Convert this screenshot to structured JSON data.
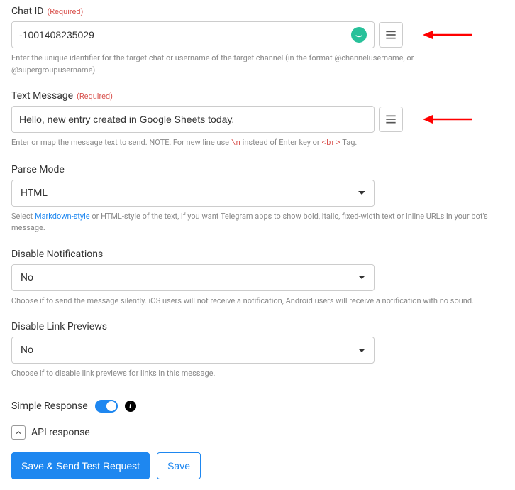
{
  "chat_id": {
    "label": "Chat ID",
    "required": "(Required)",
    "value": "-1001408235029",
    "help": "Enter the unique identifier for the target chat or username of the target channel (in the format @channelusername, or @supergroupusername)."
  },
  "text_message": {
    "label": "Text Message",
    "required": "(Required)",
    "value": "Hello, new entry created in Google Sheets today.",
    "help_prefix": "Enter or map the message text to send. NOTE: For new line use ",
    "help_code1": "\\n",
    "help_mid": " instead of Enter key or ",
    "help_code2": "<br>",
    "help_suffix": " Tag."
  },
  "parse_mode": {
    "label": "Parse Mode",
    "value": "HTML",
    "help_prefix": "Select ",
    "help_link": "Markdown-style",
    "help_suffix": " or HTML-style of the text, if you want Telegram apps to show bold, italic, fixed-width text or inline URLs in your bot's message."
  },
  "disable_notifications": {
    "label": "Disable Notifications",
    "value": "No",
    "help": "Choose if to send the message silently. iOS users will not receive a notification, Android users will receive a notification with no sound."
  },
  "disable_link_previews": {
    "label": "Disable Link Previews",
    "value": "No",
    "help": "Choose if to disable link previews for links in this message."
  },
  "simple_response": {
    "label": "Simple Response"
  },
  "api_response": {
    "label": "API response"
  },
  "buttons": {
    "save_send": "Save & Send Test Request",
    "save": "Save"
  }
}
